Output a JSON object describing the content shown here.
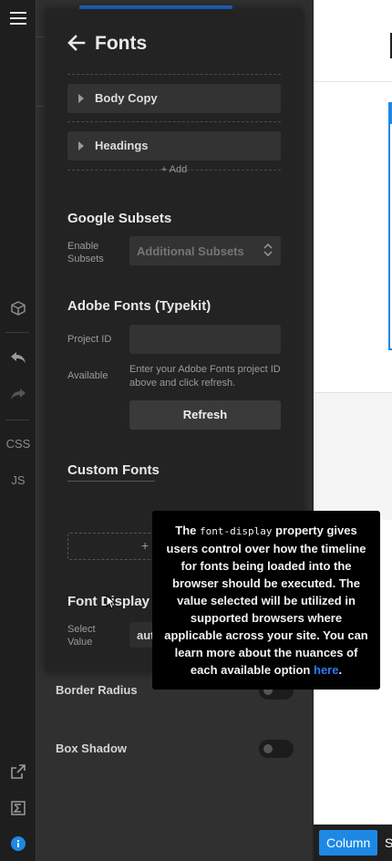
{
  "toolbar": {
    "css_label": "CSS",
    "js_label": "JS"
  },
  "panel": {
    "title": "Fonts",
    "accordions": [
      "Body Copy",
      "Headings"
    ],
    "add_label": "+ Add",
    "google_subsets": {
      "title": "Google Subsets",
      "enable_label": "Enable Subsets",
      "select_placeholder": "Additional Subsets"
    },
    "adobe": {
      "title": "Adobe Fonts (Typekit)",
      "project_id_label": "Project ID",
      "project_id_value": "",
      "available_label": "Available",
      "available_help": "Enter your Adobe Fonts project ID above and click refresh.",
      "refresh_label": "Refresh"
    },
    "custom": {
      "title": "Custom Fonts",
      "add_label": "+"
    },
    "font_display": {
      "title": "Font Display",
      "select_label": "Select Value",
      "select_value": "aut"
    }
  },
  "behind": {
    "rows": [
      "Border Radius",
      "Box Shadow"
    ]
  },
  "tooltip": {
    "pre": "The",
    "code": "font-display",
    "mid": "property gives users control over how the timeline for fonts being loaded into the browser should be executed. The value selected will be utilized in supported browsers where applicable across your site. You can learn more about the nuances of each available option",
    "link": "here",
    "post": "."
  },
  "canvas": {
    "column_btn": "Column",
    "s_btn": "S"
  },
  "colors": {
    "accent": "#1e88e5",
    "panel_bg": "#232323",
    "toolbar_bg": "#1e1e1e",
    "tooltip_bg": "#000000"
  }
}
